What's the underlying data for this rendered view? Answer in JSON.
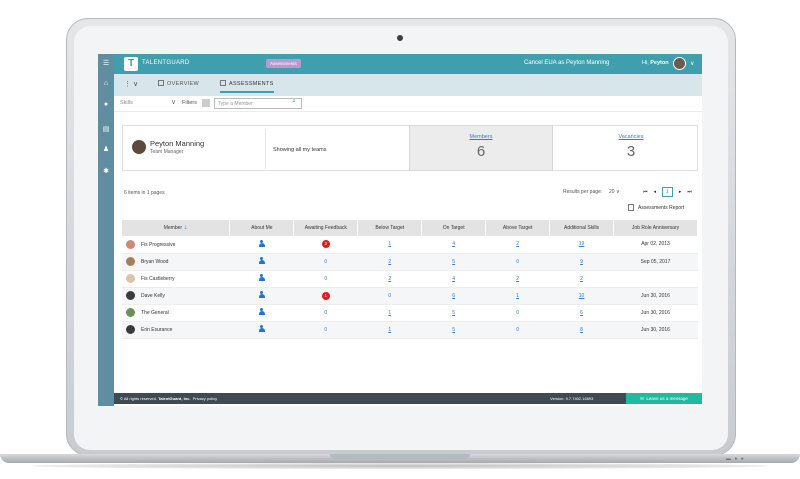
{
  "header": {
    "logo_text": "TALENTGUARD",
    "tooltip": "Assessments",
    "cancel_link": "Cancel EUA as Peyton Manning",
    "greeting_prefix": "Hi, ",
    "greeting_name": "Peyton"
  },
  "tabs": [
    {
      "label": "OVERVIEW",
      "active": false
    },
    {
      "label": "ASSESSMENTS",
      "active": true
    }
  ],
  "filters": {
    "skills_label": "Skills",
    "filters_label": "Filters",
    "search_placeholder": "Type a Member"
  },
  "summary": {
    "name": "Peyton Manning",
    "role": "Team Manager",
    "showing": "Showing all my teams",
    "members_label": "Members",
    "members_value": "6",
    "vacancies_label": "Vacancies",
    "vacancies_value": "3"
  },
  "list_info": {
    "items_count": "6 items in 1 pages",
    "results_per_page_label": "Results per page:",
    "results_per_page_value": "20",
    "current_page": "1",
    "report_label": "Assessments Report"
  },
  "table": {
    "headers": [
      "Member",
      "About Me",
      "Awaiting Feedback",
      "Below Target",
      "On Target",
      "Above Target",
      "Additional Skills",
      "Job Role Anniversary"
    ],
    "rows": [
      {
        "member": "Fis Progressive",
        "awaiting": "2",
        "awaiting_badge": true,
        "below": "1",
        "on": "4",
        "above": "2",
        "additional": "19",
        "anniversary": "Apr 02, 2013"
      },
      {
        "member": "Bryan Wood",
        "awaiting": "0",
        "awaiting_badge": false,
        "below": "2",
        "on": "5",
        "above": "0",
        "additional": "9",
        "anniversary": "Sep 05, 2017"
      },
      {
        "member": "Fis Castleberry",
        "awaiting": "0",
        "awaiting_badge": false,
        "below": "2",
        "on": "4",
        "above": "2",
        "additional": "2",
        "anniversary": ""
      },
      {
        "member": "Dave Kelly",
        "awaiting": "1",
        "awaiting_badge": true,
        "below": "0",
        "on": "6",
        "above": "1",
        "additional": "10",
        "anniversary": "Jun 30, 2016"
      },
      {
        "member": "The General",
        "awaiting": "0",
        "awaiting_badge": false,
        "below": "1",
        "on": "5",
        "above": "0",
        "additional": "6",
        "anniversary": "Jun 30, 2016"
      },
      {
        "member": "Erin Esurance",
        "awaiting": "0",
        "awaiting_badge": false,
        "below": "1",
        "on": "5",
        "above": "0",
        "additional": "8",
        "anniversary": "Jun 30, 2016"
      }
    ]
  },
  "footer": {
    "copyright_prefix": "© All rights reserved. ",
    "copyright_company": "TalentGuard, Inc.",
    "privacy": "Privacy policy",
    "version": "Version: 9.7.7402.16693",
    "message_button": "Leave us a message"
  },
  "colors": {
    "brand_teal": "#3f9fad",
    "sidebar": "#5e8e9f",
    "link_blue": "#2d7ed6",
    "badge_red": "#e31b1b",
    "footer_dark": "#3f4a52",
    "message_green": "#1fbaa0"
  },
  "icons": [
    "hamburger-icon",
    "home-icon",
    "person-icon",
    "book-icon",
    "person-add-icon",
    "group-icon",
    "search-icon",
    "chevron-down-icon",
    "report-icon",
    "message-icon"
  ]
}
